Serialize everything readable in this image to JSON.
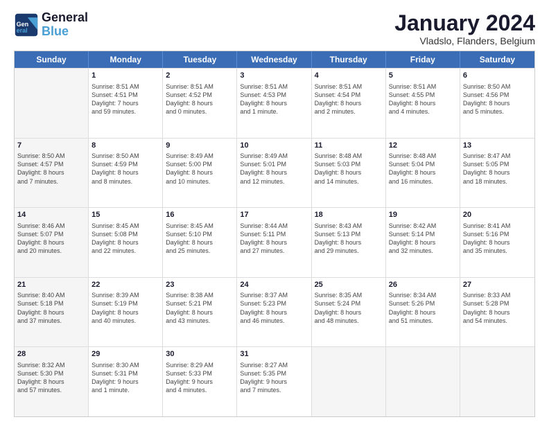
{
  "header": {
    "logo_line1": "General",
    "logo_line2": "Blue",
    "month_title": "January 2024",
    "subtitle": "Vladslo, Flanders, Belgium"
  },
  "weekdays": [
    "Sunday",
    "Monday",
    "Tuesday",
    "Wednesday",
    "Thursday",
    "Friday",
    "Saturday"
  ],
  "rows": [
    [
      {
        "day": "",
        "info": "",
        "shaded": true
      },
      {
        "day": "1",
        "info": "Sunrise: 8:51 AM\nSunset: 4:51 PM\nDaylight: 7 hours\nand 59 minutes.",
        "shaded": false
      },
      {
        "day": "2",
        "info": "Sunrise: 8:51 AM\nSunset: 4:52 PM\nDaylight: 8 hours\nand 0 minutes.",
        "shaded": false
      },
      {
        "day": "3",
        "info": "Sunrise: 8:51 AM\nSunset: 4:53 PM\nDaylight: 8 hours\nand 1 minute.",
        "shaded": false
      },
      {
        "day": "4",
        "info": "Sunrise: 8:51 AM\nSunset: 4:54 PM\nDaylight: 8 hours\nand 2 minutes.",
        "shaded": false
      },
      {
        "day": "5",
        "info": "Sunrise: 8:51 AM\nSunset: 4:55 PM\nDaylight: 8 hours\nand 4 minutes.",
        "shaded": false
      },
      {
        "day": "6",
        "info": "Sunrise: 8:50 AM\nSunset: 4:56 PM\nDaylight: 8 hours\nand 5 minutes.",
        "shaded": false
      }
    ],
    [
      {
        "day": "7",
        "info": "Sunrise: 8:50 AM\nSunset: 4:57 PM\nDaylight: 8 hours\nand 7 minutes.",
        "shaded": true
      },
      {
        "day": "8",
        "info": "Sunrise: 8:50 AM\nSunset: 4:59 PM\nDaylight: 8 hours\nand 8 minutes.",
        "shaded": false
      },
      {
        "day": "9",
        "info": "Sunrise: 8:49 AM\nSunset: 5:00 PM\nDaylight: 8 hours\nand 10 minutes.",
        "shaded": false
      },
      {
        "day": "10",
        "info": "Sunrise: 8:49 AM\nSunset: 5:01 PM\nDaylight: 8 hours\nand 12 minutes.",
        "shaded": false
      },
      {
        "day": "11",
        "info": "Sunrise: 8:48 AM\nSunset: 5:03 PM\nDaylight: 8 hours\nand 14 minutes.",
        "shaded": false
      },
      {
        "day": "12",
        "info": "Sunrise: 8:48 AM\nSunset: 5:04 PM\nDaylight: 8 hours\nand 16 minutes.",
        "shaded": false
      },
      {
        "day": "13",
        "info": "Sunrise: 8:47 AM\nSunset: 5:05 PM\nDaylight: 8 hours\nand 18 minutes.",
        "shaded": false
      }
    ],
    [
      {
        "day": "14",
        "info": "Sunrise: 8:46 AM\nSunset: 5:07 PM\nDaylight: 8 hours\nand 20 minutes.",
        "shaded": true
      },
      {
        "day": "15",
        "info": "Sunrise: 8:45 AM\nSunset: 5:08 PM\nDaylight: 8 hours\nand 22 minutes.",
        "shaded": false
      },
      {
        "day": "16",
        "info": "Sunrise: 8:45 AM\nSunset: 5:10 PM\nDaylight: 8 hours\nand 25 minutes.",
        "shaded": false
      },
      {
        "day": "17",
        "info": "Sunrise: 8:44 AM\nSunset: 5:11 PM\nDaylight: 8 hours\nand 27 minutes.",
        "shaded": false
      },
      {
        "day": "18",
        "info": "Sunrise: 8:43 AM\nSunset: 5:13 PM\nDaylight: 8 hours\nand 29 minutes.",
        "shaded": false
      },
      {
        "day": "19",
        "info": "Sunrise: 8:42 AM\nSunset: 5:14 PM\nDaylight: 8 hours\nand 32 minutes.",
        "shaded": false
      },
      {
        "day": "20",
        "info": "Sunrise: 8:41 AM\nSunset: 5:16 PM\nDaylight: 8 hours\nand 35 minutes.",
        "shaded": false
      }
    ],
    [
      {
        "day": "21",
        "info": "Sunrise: 8:40 AM\nSunset: 5:18 PM\nDaylight: 8 hours\nand 37 minutes.",
        "shaded": true
      },
      {
        "day": "22",
        "info": "Sunrise: 8:39 AM\nSunset: 5:19 PM\nDaylight: 8 hours\nand 40 minutes.",
        "shaded": false
      },
      {
        "day": "23",
        "info": "Sunrise: 8:38 AM\nSunset: 5:21 PM\nDaylight: 8 hours\nand 43 minutes.",
        "shaded": false
      },
      {
        "day": "24",
        "info": "Sunrise: 8:37 AM\nSunset: 5:23 PM\nDaylight: 8 hours\nand 46 minutes.",
        "shaded": false
      },
      {
        "day": "25",
        "info": "Sunrise: 8:35 AM\nSunset: 5:24 PM\nDaylight: 8 hours\nand 48 minutes.",
        "shaded": false
      },
      {
        "day": "26",
        "info": "Sunrise: 8:34 AM\nSunset: 5:26 PM\nDaylight: 8 hours\nand 51 minutes.",
        "shaded": false
      },
      {
        "day": "27",
        "info": "Sunrise: 8:33 AM\nSunset: 5:28 PM\nDaylight: 8 hours\nand 54 minutes.",
        "shaded": false
      }
    ],
    [
      {
        "day": "28",
        "info": "Sunrise: 8:32 AM\nSunset: 5:30 PM\nDaylight: 8 hours\nand 57 minutes.",
        "shaded": true
      },
      {
        "day": "29",
        "info": "Sunrise: 8:30 AM\nSunset: 5:31 PM\nDaylight: 9 hours\nand 1 minute.",
        "shaded": false
      },
      {
        "day": "30",
        "info": "Sunrise: 8:29 AM\nSunset: 5:33 PM\nDaylight: 9 hours\nand 4 minutes.",
        "shaded": false
      },
      {
        "day": "31",
        "info": "Sunrise: 8:27 AM\nSunset: 5:35 PM\nDaylight: 9 hours\nand 7 minutes.",
        "shaded": false
      },
      {
        "day": "",
        "info": "",
        "shaded": true
      },
      {
        "day": "",
        "info": "",
        "shaded": true
      },
      {
        "day": "",
        "info": "",
        "shaded": true
      }
    ]
  ]
}
